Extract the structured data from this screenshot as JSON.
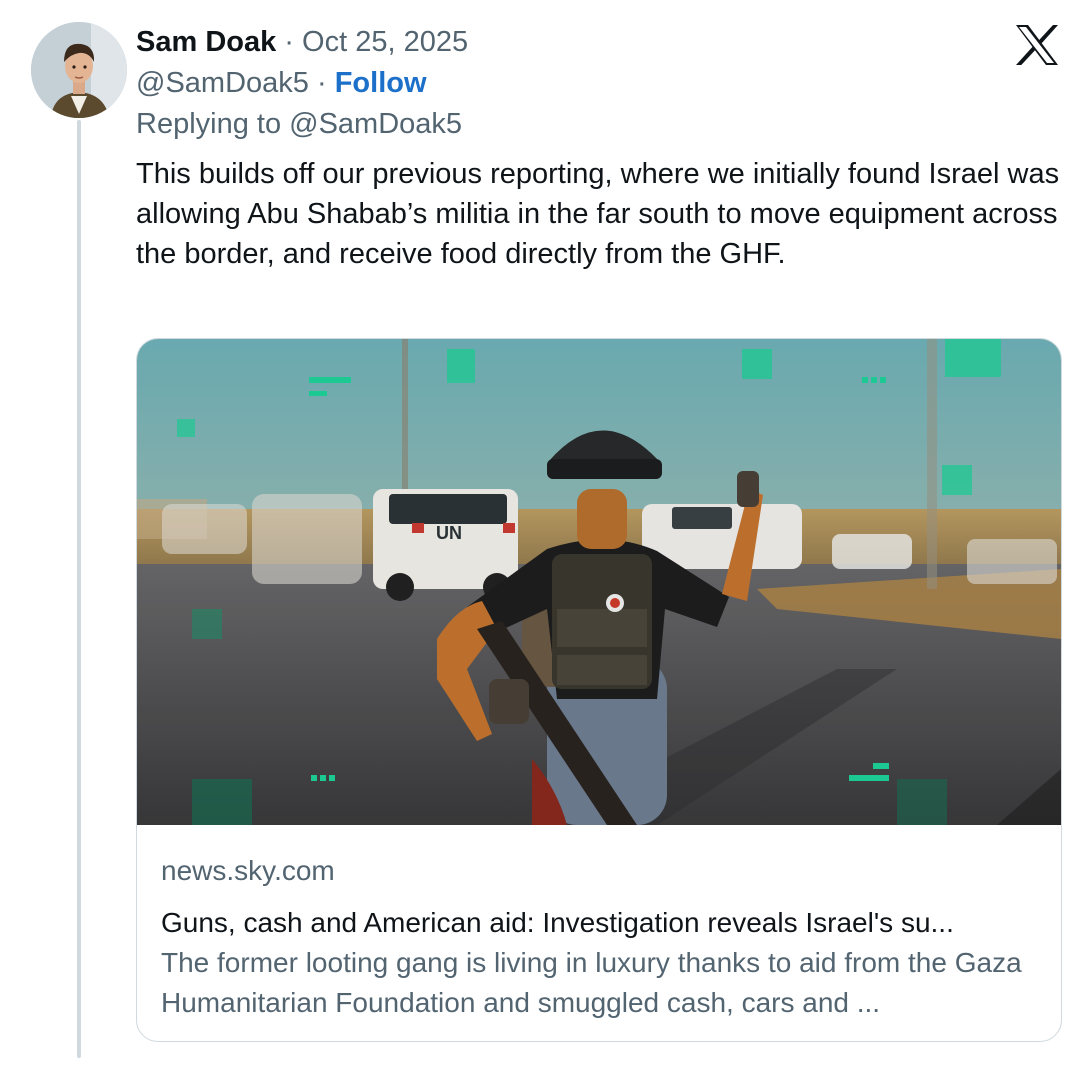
{
  "author": {
    "name": "Sam Doak",
    "date": "Oct 25, 2025",
    "handle": "@SamDoak5",
    "follow_label": "Follow",
    "separator": "·"
  },
  "reply_context": "Replying to @SamDoak5",
  "tweet_text": "This builds off our previous reporting, where we initially found Israel was allowing Abu Shabab’s militia in the far south to move equipment across the border, and receive food directly from the GHF.",
  "link_card": {
    "domain": "news.sky.com",
    "title": "Guns, cash and American aid: Investigation reveals Israel's su...",
    "description": "The former looting gang is living in luxury thanks to aid from the Gaza Humanitarian Foundation and smuggled cash, cars and ...",
    "image_vehicle_marking": "UN"
  },
  "icons": {
    "platform_logo": "x-logo-icon",
    "avatar": "avatar"
  },
  "colors": {
    "follow_accent": "#1d70c9",
    "secondary_text": "#536471",
    "thread_line": "#cfd9de"
  }
}
